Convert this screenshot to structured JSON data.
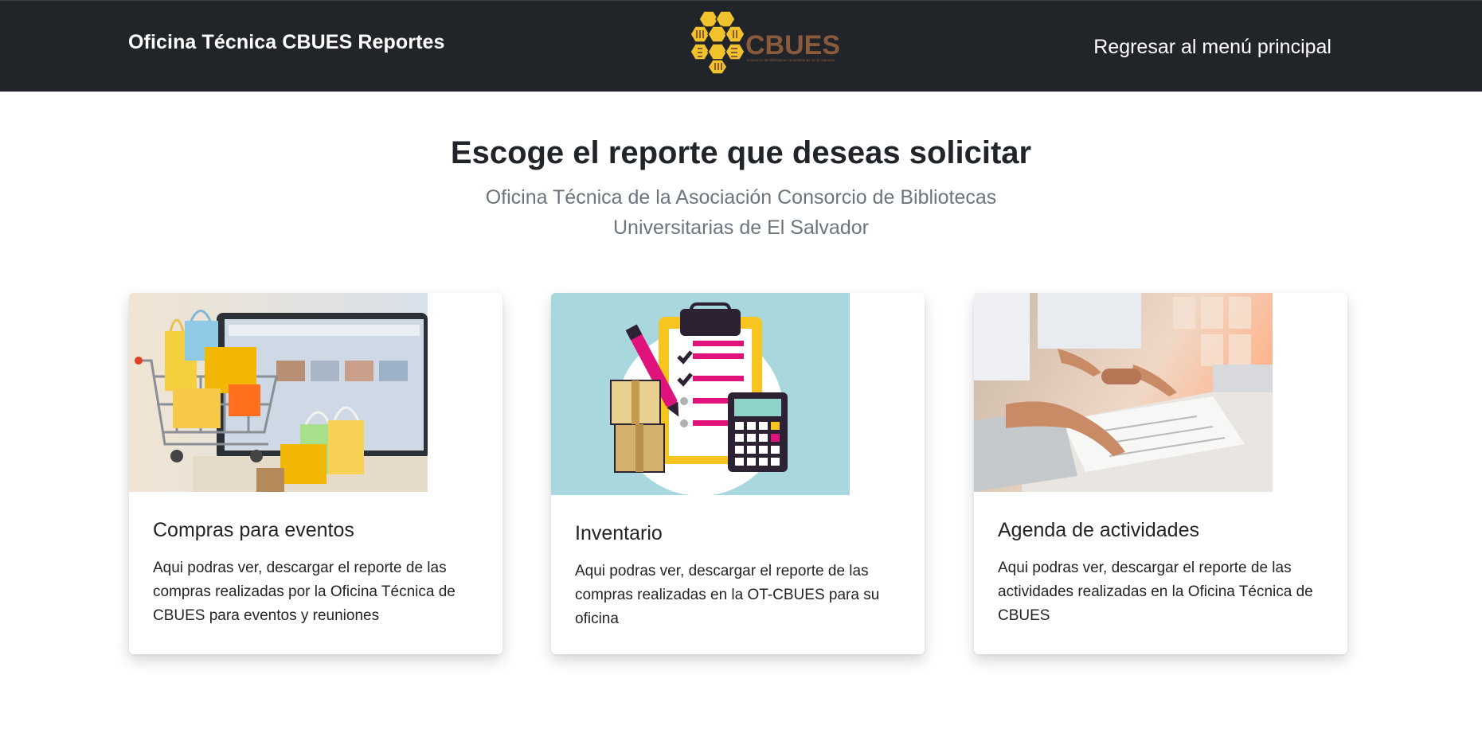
{
  "navbar": {
    "brand": "Oficina Técnica CBUES Reportes",
    "logo_text": "CBUES",
    "logo_subtext": "Consorcio de Bibliotecas Universitarias de El Salvador",
    "back_link": "Regresar al menú principal",
    "background": "#212529"
  },
  "hero": {
    "title": "Escoge el reporte que deseas solicitar",
    "subtitle": "Oficina Técnica de la Asociación Consorcio de Bibliotecas Universitarias de El Salvador"
  },
  "cards": [
    {
      "title": "Compras para eventos",
      "text": "Aqui podras ver, descargar el reporte de las compras realizadas por la Oficina Técnica de CBUES para eventos y reuniones",
      "image_icon": "shopping-cart-laptop-image"
    },
    {
      "title": "Inventario",
      "text": "Aqui podras ver, descargar el reporte de las compras realizadas en la OT-CBUES para su oficina",
      "image_icon": "clipboard-inventory-image"
    },
    {
      "title": "Agenda de actividades",
      "text": "Aqui podras ver, descargar el reporte de las actividades realizadas en la Oficina Técnica de CBUES",
      "image_icon": "office-meeting-image"
    }
  ],
  "colors": {
    "logo_gold": "#f2c22d",
    "logo_brown": "#8a5a3c",
    "muted_text": "#6c757d"
  }
}
